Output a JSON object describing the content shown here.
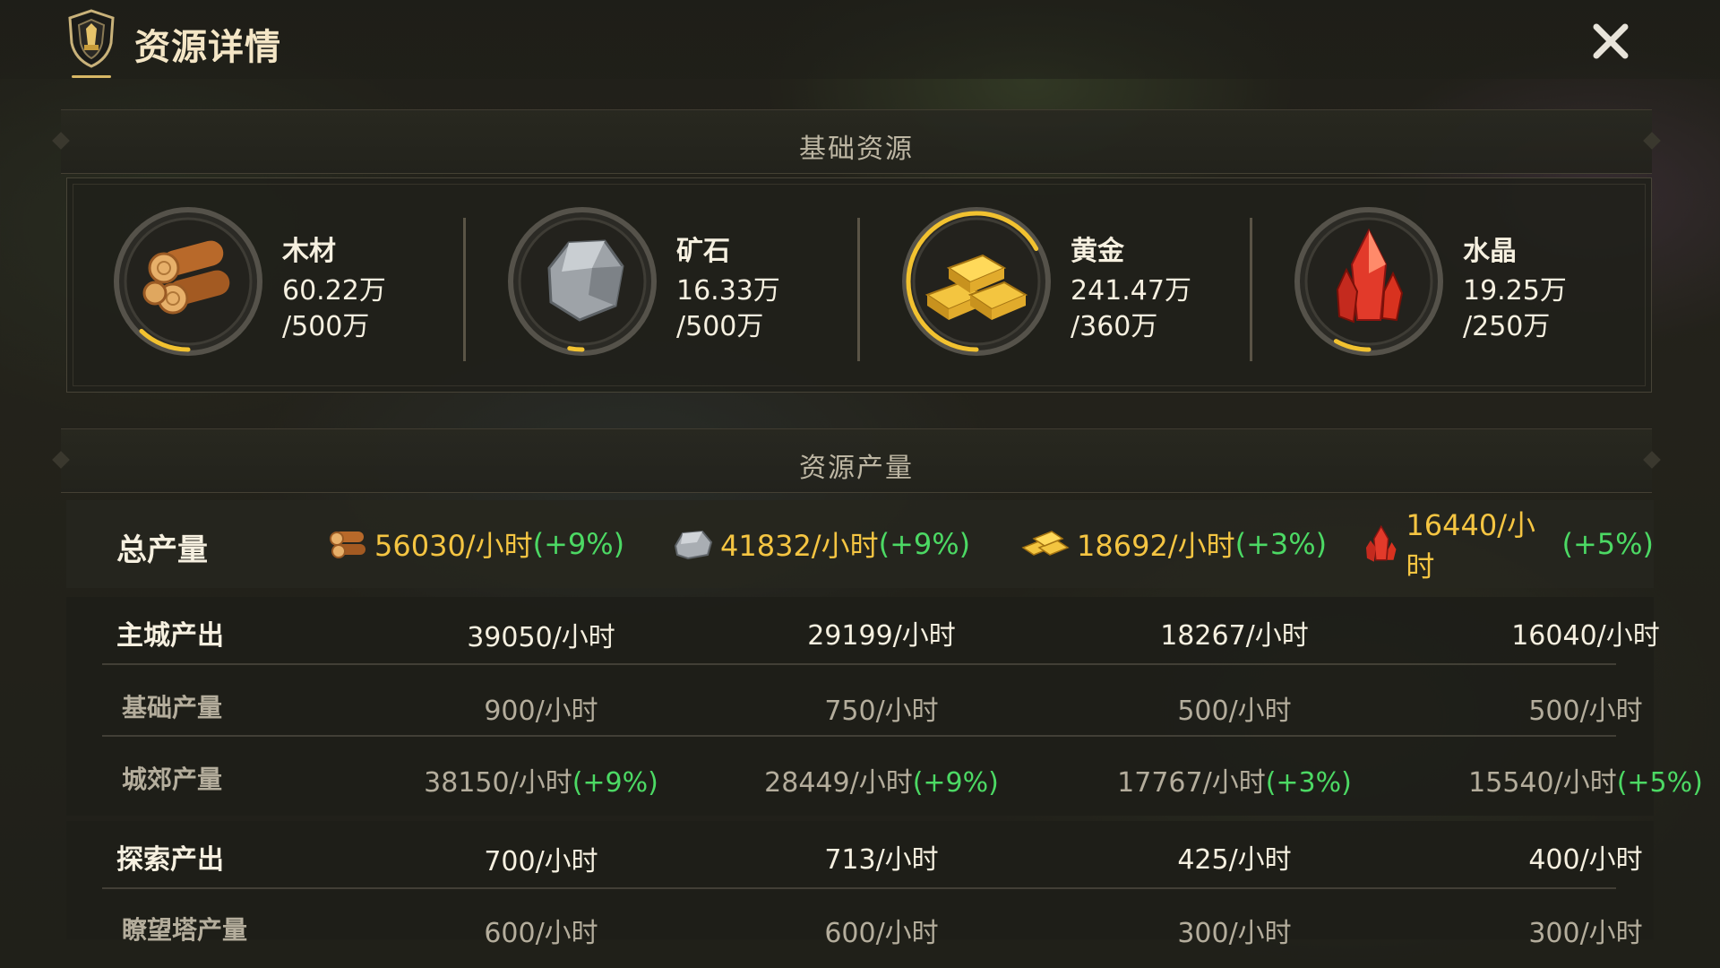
{
  "header": {
    "title": "资源详情",
    "icon": "shield-emblem-icon"
  },
  "sections": {
    "basic": "基础资源",
    "production": "资源产量"
  },
  "resources": [
    {
      "name": "木材",
      "amount": "60.22万",
      "cap": "/500万",
      "fill": 0.12,
      "icon": "wood-logs-icon"
    },
    {
      "name": "矿石",
      "amount": "16.33万",
      "cap": "/500万",
      "fill": 0.03,
      "icon": "ore-stone-icon"
    },
    {
      "name": "黄金",
      "amount": "241.47万",
      "cap": "/360万",
      "fill": 0.67,
      "icon": "gold-bars-icon"
    },
    {
      "name": "水晶",
      "amount": "19.25万",
      "cap": "/250万",
      "fill": 0.08,
      "icon": "crystal-icon"
    }
  ],
  "totals": {
    "label": "总产量",
    "items": [
      {
        "value": "56030/小时",
        "bonus": "(+9%)",
        "icon": "wood-logs-icon"
      },
      {
        "value": "41832/小时",
        "bonus": "(+9%)",
        "icon": "ore-stone-icon"
      },
      {
        "value": "18692/小时",
        "bonus": "(+3%)",
        "icon": "gold-bars-icon"
      },
      {
        "value": "16440/小时",
        "bonus": "(+5%)",
        "icon": "crystal-icon"
      }
    ]
  },
  "main_city": {
    "label": "主城产出",
    "values": [
      "39050/小时",
      "29199/小时",
      "18267/小时",
      "16040/小时"
    ],
    "base": {
      "label": "基础产量",
      "values": [
        "900/小时",
        "750/小时",
        "500/小时",
        "500/小时"
      ]
    },
    "suburb": {
      "label": "城郊产量",
      "values": [
        "38150/小时",
        "28449/小时",
        "17767/小时",
        "15540/小时"
      ],
      "bonuses": [
        "(+9%)",
        "(+9%)",
        "(+3%)",
        "(+5%)"
      ]
    }
  },
  "explore": {
    "label": "探索产出",
    "values": [
      "700/小时",
      "713/小时",
      "425/小时",
      "400/小时"
    ],
    "watchtower": {
      "label": "瞭望塔产量",
      "values": [
        "600/小时",
        "600/小时",
        "300/小时",
        "300/小时"
      ]
    }
  },
  "colors": {
    "accent_gold": "#f5c542",
    "bonus_green": "#4cd964",
    "ring_fill": "#f2c230"
  }
}
